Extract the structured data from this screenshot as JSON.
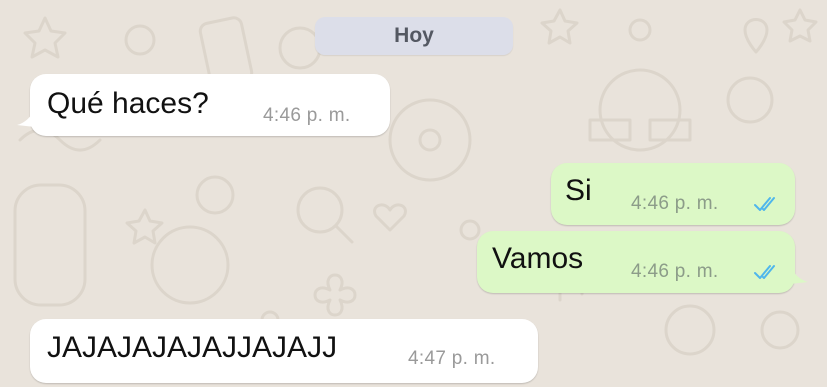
{
  "chat": {
    "date_label": "Hoy",
    "messages": [
      {
        "direction": "in",
        "text": "Qué haces?",
        "time": "4:46 p. m."
      },
      {
        "direction": "out",
        "text": "Si",
        "time": "4:46 p. m.",
        "status": "read-double-check-icon"
      },
      {
        "direction": "out",
        "text": "Vamos",
        "time": "4:46 p. m.",
        "status": "read-double-check-icon"
      },
      {
        "direction": "in",
        "text": "JAJAJAJAJAJJAJAJJ",
        "time": "4:47 p. m."
      }
    ]
  },
  "colors": {
    "wallpaper": "#e9e3db",
    "incoming_bubble": "#ffffff",
    "outgoing_bubble": "#dcf8c6",
    "date_chip": "#dcdee9",
    "read_ticks": "#4fb6ec"
  }
}
